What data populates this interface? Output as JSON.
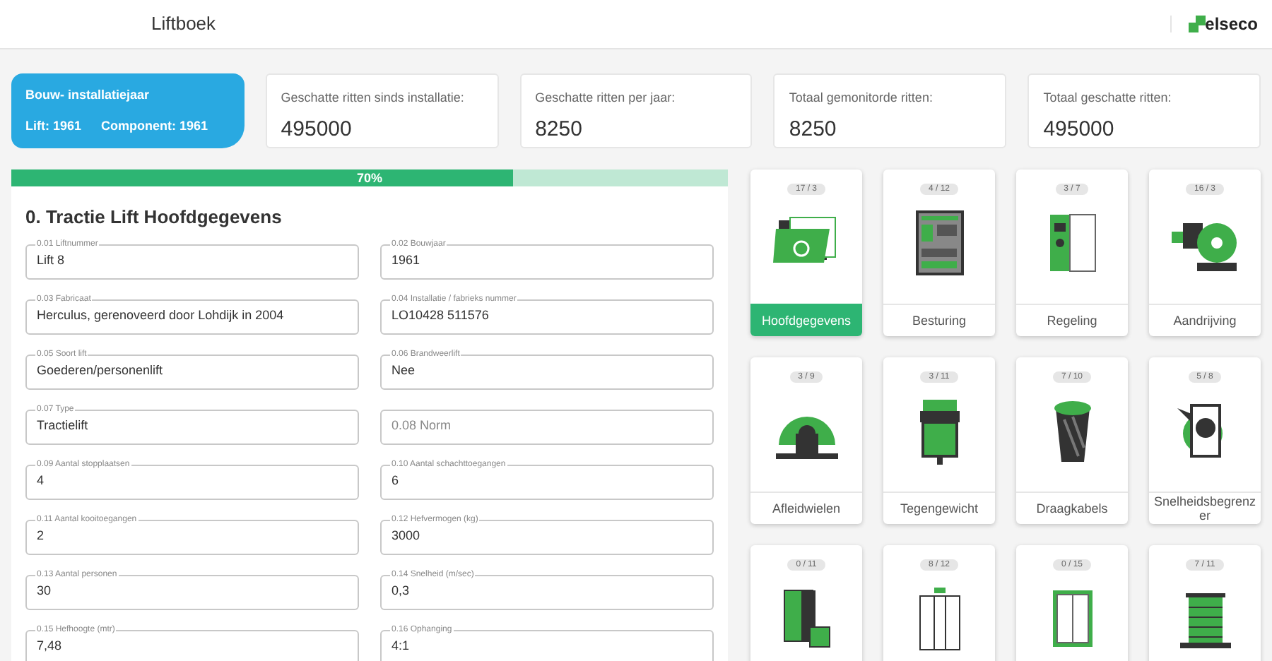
{
  "header": {
    "title": "Liftboek",
    "logo_text": "elseco"
  },
  "build_year_card": {
    "title": "Bouw- installatiejaar",
    "lift": "Lift: 1961",
    "component": "Component: 1961"
  },
  "stats": [
    {
      "label": "Geschatte ritten sinds installatie:",
      "value": "495000"
    },
    {
      "label": "Geschatte ritten per jaar:",
      "value": "8250"
    },
    {
      "label": "Totaal gemonitorde ritten:",
      "value": "8250"
    },
    {
      "label": "Totaal geschatte ritten:",
      "value": "495000"
    }
  ],
  "progress": {
    "level": 0.7,
    "reading": "70%"
  },
  "form": {
    "title": "0. Tractie Lift Hoofdgegevens",
    "fields": [
      {
        "label": "0.01 Liftnummer",
        "value": "Lift 8"
      },
      {
        "label": "0.02 Bouwjaar",
        "value": "1961"
      },
      {
        "label": "0.03 Fabricaat",
        "value": "Herculus, gerenoveerd door Lohdijk in 2004"
      },
      {
        "label": "0.04 Installatie / fabrieks nummer",
        "value": "LO10428 511576"
      },
      {
        "label": "0.05 Soort lift",
        "value": "Goederen/personenlift"
      },
      {
        "label": "0.06 Brandweerlift",
        "value": "Nee"
      },
      {
        "label": "0.07 Type",
        "value": "Tractielift"
      },
      {
        "placeholder": "0.08 Norm"
      },
      {
        "label": "0.09 Aantal stopplaatsen",
        "value": "4"
      },
      {
        "label": "0.10 Aantal schachttoegangen",
        "value": "6"
      },
      {
        "label": "0.11 Aantal kooitoegangen",
        "value": "2"
      },
      {
        "label": "0.12 Hefvermogen (kg)",
        "value": "3000"
      },
      {
        "label": "0.13 Aantal personen",
        "value": "30"
      },
      {
        "label": "0.14 Snelheid (m/sec)",
        "value": "0,3"
      },
      {
        "label": "0.15 Hefhoogte (mtr)",
        "value": "7,48"
      },
      {
        "label": "0.16 Ophanging",
        "value": "4:1"
      }
    ]
  },
  "tiles": [
    {
      "count": "17 / 3",
      "label": "Hoofdgegevens",
      "selected": true
    },
    {
      "count": "4 / 12",
      "label": "Besturing",
      "selected": false
    },
    {
      "count": "3 / 7",
      "label": "Regeling",
      "selected": false
    },
    {
      "count": "16 / 3",
      "label": "Aandrijving",
      "selected": false
    },
    {
      "count": "3 / 9",
      "label": "Afleidwielen",
      "selected": false
    },
    {
      "count": "3 / 11",
      "label": "Tegengewicht",
      "selected": false
    },
    {
      "count": "7 / 10",
      "label": "Draagkabels",
      "selected": false
    },
    {
      "count": "5 / 8",
      "label": "Snelheidsbegrenzer",
      "selected": false
    },
    {
      "count": "0 / 11"
    },
    {
      "count": "8 / 12"
    },
    {
      "count": "0 / 15"
    },
    {
      "count": "7 / 11"
    }
  ]
}
